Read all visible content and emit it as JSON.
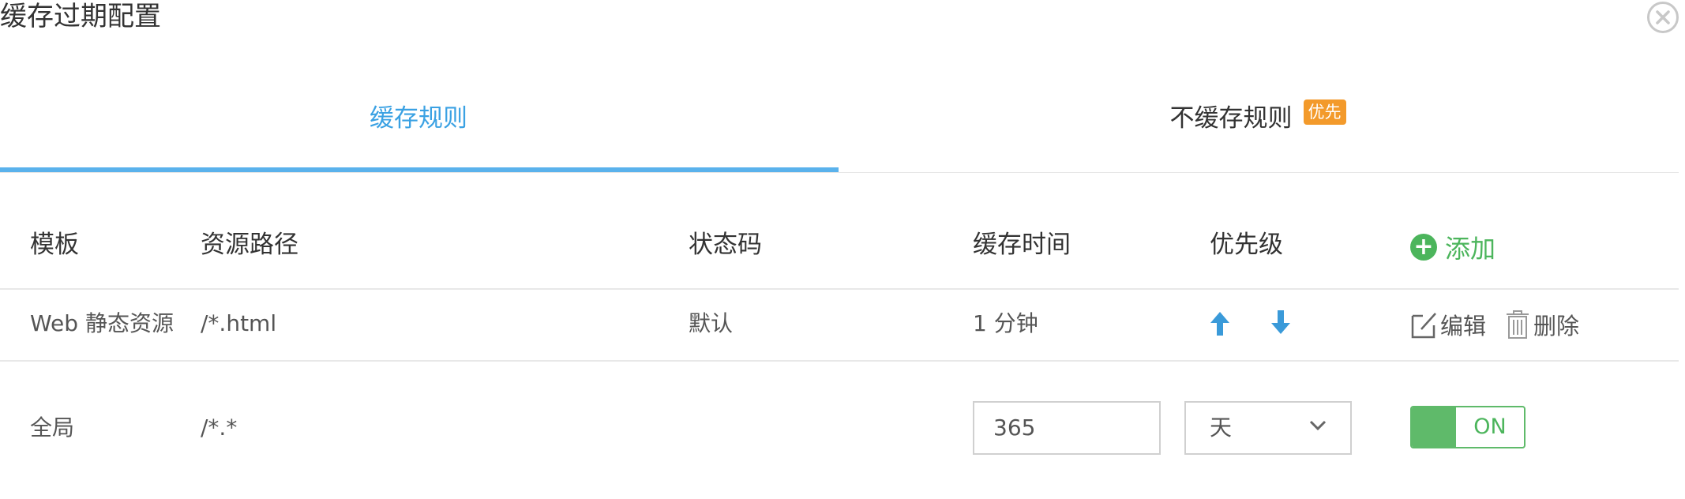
{
  "dialog": {
    "title": "缓存过期配置"
  },
  "tabs": [
    {
      "label": "缓存规则",
      "active": true
    },
    {
      "label": "不缓存规则",
      "badge": "优先",
      "active": false
    }
  ],
  "table": {
    "headers": {
      "template": "模板",
      "path": "资源路径",
      "status_code": "状态码",
      "cache_time": "缓存时间",
      "priority": "优先级",
      "add": "添加"
    },
    "rows": [
      {
        "template": "Web 静态资源",
        "path": "/*.html",
        "status_code": "默认",
        "cache_time": "1 分钟",
        "edit": "编辑",
        "delete": "删除"
      }
    ],
    "global_row": {
      "template": "全局",
      "path": "/*.*",
      "time_value": "365",
      "time_unit": "天",
      "toggle": "ON"
    }
  },
  "colors": {
    "accent": "#3aa1e3",
    "success": "#4cb55c",
    "badge": "#f39a2b"
  }
}
